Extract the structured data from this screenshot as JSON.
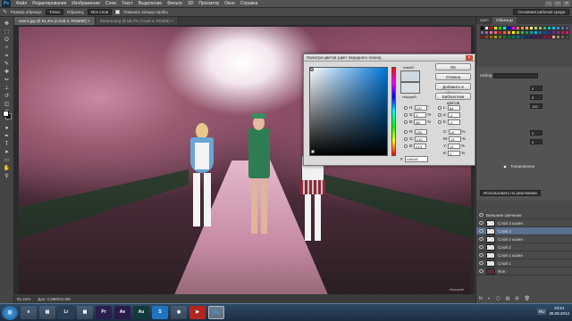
{
  "menubar": {
    "logo": "Ps",
    "items": [
      "Файл",
      "Редактирование",
      "Изображение",
      "Слои",
      "Текст",
      "Выделение",
      "Фильтр",
      "3D",
      "Просмотр",
      "Окно",
      "Справка"
    ]
  },
  "options": {
    "size_label": "Размер образца:",
    "size_value": "Точка",
    "sample_label": "Образец:",
    "sample_value": "Все слои",
    "show_ring_label": "Показать кольцо пробы",
    "workspace": "Основная рабочая среда"
  },
  "tabs": [
    {
      "label": "сингл.jpg @ 91,4% (Слой 4, RGB/8#) ×",
      "active": true
    },
    {
      "label": "Катана.png @ 66,7% (Слой 3, RGB/8) ×",
      "active": false
    }
  ],
  "status": {
    "zoom": "91,43%",
    "doc": "Док: 4,38M/22,9M"
  },
  "watermark": "rfsmuzhe",
  "dialog": {
    "title": "Палитра цветов (цвет переднего плана)",
    "close": "×",
    "new_label": "новый",
    "current_label": "текущий",
    "buttons": [
      "OK",
      "Отмена",
      "Добавить в образцы",
      "Библиотеки цветов"
    ],
    "webonly_label": "Только Web-цвета",
    "fields_left": [
      {
        "label": "H:",
        "value": "207",
        "unit": "°"
      },
      {
        "label": "S:",
        "value": "3",
        "unit": "%"
      },
      {
        "label": "B:",
        "value": "86",
        "unit": "%"
      },
      {
        "label": "R:",
        "value": "205",
        "unit": ""
      },
      {
        "label": "G:",
        "value": "210",
        "unit": ""
      },
      {
        "label": "B:",
        "value": "213",
        "unit": ""
      }
    ],
    "fields_right": [
      {
        "label": "L:",
        "value": "84",
        "unit": ""
      },
      {
        "label": "a:",
        "value": "-2",
        "unit": ""
      },
      {
        "label": "b:",
        "value": "-2",
        "unit": ""
      },
      {
        "label": "C:",
        "value": "18",
        "unit": "%"
      },
      {
        "label": "M:",
        "value": "13",
        "unit": "%"
      },
      {
        "label": "Y:",
        "value": "12",
        "unit": "%"
      },
      {
        "label": "K:",
        "value": "0",
        "unit": "%"
      }
    ],
    "hex_label": "#",
    "hex_value": "cdd2d5"
  },
  "panels": {
    "tabs": [
      "Цвет",
      "Образцы"
    ],
    "swatch_colors": [
      "#000000",
      "#ffffff",
      "#ff0000",
      "#ffff00",
      "#00ff00",
      "#00ffff",
      "#0000ff",
      "#ff00ff",
      "#f26c4f",
      "#f68e55",
      "#fbaf5c",
      "#fff467",
      "#acd372",
      "#7cc576",
      "#3bb878",
      "#1abbb4",
      "#00bff3",
      "#438ccb",
      "#5574b9",
      "#605ca8",
      "#855fa8",
      "#a763a8",
      "#f06ea9",
      "#f26d7d",
      "#ed1c24",
      "#f26522",
      "#f7941d",
      "#fff200",
      "#8dc63f",
      "#39b54a",
      "#00a651",
      "#00a99d",
      "#00aeef",
      "#0072bc",
      "#0054a6",
      "#2e3192",
      "#662d91",
      "#92278f",
      "#ec008c",
      "#ed145b",
      "#9e0b0f",
      "#a0410d",
      "#a36209",
      "#aba000",
      "#598527",
      "#1a7b30",
      "#007236",
      "#00746b",
      "#0076a3",
      "#004b80",
      "#003471",
      "#1b1464",
      "#440e62",
      "#630460",
      "#9e005d",
      "#9e0039",
      "#c7b299",
      "#998675",
      "#736357",
      "#534741"
    ],
    "adjust": {
      "preset_label": "Набор",
      "value1": "0",
      "value2": "0",
      "value3": "100",
      "value4": "0",
      "value5": "0",
      "colorize_label": "Тонирование",
      "apply_label": "Использовать по умолчанию"
    },
    "layers": [
      {
        "name": "Внешнее свечение",
        "sel": false
      },
      {
        "name": "Слой 3 копия",
        "sel": false
      },
      {
        "name": "Слой 3",
        "sel": true
      },
      {
        "name": "Слой 2 копия",
        "sel": false
      },
      {
        "name": "Слой 2",
        "sel": false
      },
      {
        "name": "Слой 1 копия",
        "sel": false
      },
      {
        "name": "Слой 1",
        "sel": false
      },
      {
        "name": "Фон",
        "sel": false
      }
    ],
    "layer_buttons": [
      "fx",
      "◐",
      "▢",
      "▤",
      "⊞",
      "🗑"
    ]
  },
  "taskbar": {
    "start": "⊞",
    "apps": [
      "e",
      "▤",
      "Lr",
      "▦",
      "Pr",
      "Ae",
      "Au",
      "S",
      "◉",
      "▶",
      "Ps"
    ],
    "lang": "RU",
    "time": "23:51",
    "date": "26.08.2014"
  }
}
